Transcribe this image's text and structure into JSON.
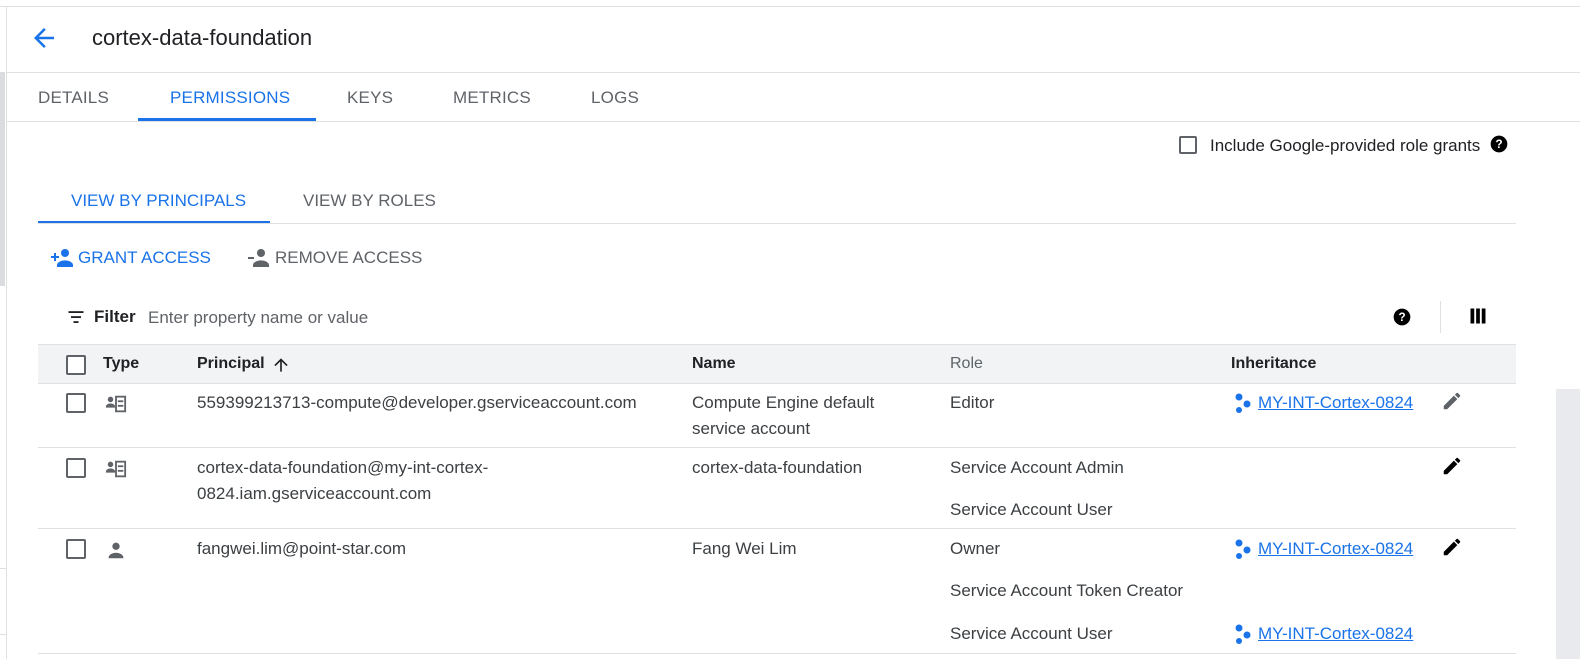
{
  "header": {
    "title": "cortex-data-foundation"
  },
  "tabs": [
    {
      "label": "DETAILS"
    },
    {
      "label": "PERMISSIONS"
    },
    {
      "label": "KEYS"
    },
    {
      "label": "METRICS"
    },
    {
      "label": "LOGS"
    }
  ],
  "include_google_grants": {
    "label": "Include Google-provided role grants",
    "checked": false
  },
  "subtabs": [
    {
      "label": "VIEW BY PRINCIPALS"
    },
    {
      "label": "VIEW BY ROLES"
    }
  ],
  "actions": {
    "grant": "GRANT ACCESS",
    "remove": "REMOVE ACCESS"
  },
  "filter": {
    "label": "Filter",
    "placeholder": "Enter property name or value"
  },
  "table": {
    "columns": {
      "type": "Type",
      "principal": "Principal",
      "name": "Name",
      "role": "Role",
      "inheritance": "Inheritance"
    },
    "rows": [
      {
        "type_icon": "service-account-icon",
        "principal": "559399213713-compute@developer.gserviceaccount.com",
        "name": "Compute Engine default service account",
        "roles": [
          "Editor"
        ],
        "inheritance": [
          "MY-INT-Cortex-0824"
        ]
      },
      {
        "type_icon": "service-account-icon",
        "principal": "cortex-data-foundation@my-int-cortex-0824.iam.gserviceaccount.com",
        "name": "cortex-data-foundation",
        "roles": [
          "Service Account Admin",
          "Service Account User"
        ],
        "inheritance": []
      },
      {
        "type_icon": "person-icon",
        "principal": "fangwei.lim@point-star.com",
        "name": "Fang Wei Lim",
        "roles": [
          "Owner",
          "Service Account Token Creator",
          "Service Account User"
        ],
        "inheritance": [
          "MY-INT-Cortex-0824",
          "",
          "MY-INT-Cortex-0824"
        ]
      }
    ]
  },
  "colors": {
    "accent": "#1a73e8",
    "text": "#202124",
    "muted": "#5f6368",
    "header_bg": "#f1f3f4",
    "divider": "#e0e0e0"
  }
}
